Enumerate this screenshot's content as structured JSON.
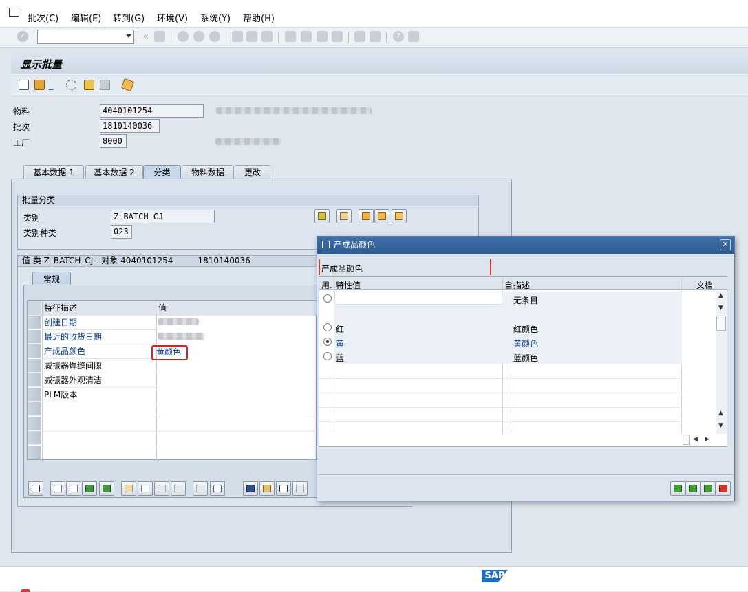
{
  "menu": [
    "批次(C)",
    "编辑(E)",
    "转到(G)",
    "环境(V)",
    "系统(Y)",
    "帮助(H)"
  ],
  "screen_title": "显示批量",
  "header": {
    "material_label": "物料",
    "material_value": "4040101254",
    "batch_label": "批次",
    "batch_value": "1810140036",
    "plant_label": "工厂",
    "plant_value": "8000"
  },
  "tabs": [
    "基本数据 1",
    "基本数据 2",
    "分类",
    "物料数据",
    "更改"
  ],
  "selected_tab": "分类",
  "batch_class": {
    "group_title": "批量分类",
    "class_label": "类别",
    "class_value": "Z_BATCH_CJ",
    "class_type_label": "类别种类",
    "class_type_value": "023"
  },
  "values": {
    "group_title": "值 类 Z_BATCH_CJ - 对象 4040101254",
    "batch_number": "1810140036",
    "subtab": "常规",
    "col_char": "特征描述",
    "col_value": "值",
    "rows": [
      {
        "char": "创建日期",
        "value": "",
        "link": true
      },
      {
        "char": "最近的收货日期",
        "value": "",
        "link": true
      },
      {
        "char": "产成品颜色",
        "value": "黄颜色",
        "link": true
      },
      {
        "char": "减振器焊缝间隙",
        "value": "",
        "link": false
      },
      {
        "char": "减振器外观清洁",
        "value": "",
        "link": false
      },
      {
        "char": "PLM版本",
        "value": "",
        "link": false
      }
    ]
  },
  "popup": {
    "title": "产成品颜色",
    "field_label": "产成品颜色",
    "col_use": "用.",
    "col_value": "特性值",
    "col_self": "自",
    "col_desc": "描述",
    "col_doc": "文档",
    "options": [
      {
        "value": "",
        "desc": "无条目",
        "selected": false
      },
      {
        "value": "红",
        "desc": "红颜色",
        "selected": false
      },
      {
        "value": "黄",
        "desc": "黄颜色",
        "selected": true
      },
      {
        "value": "蓝",
        "desc": "蓝颜色",
        "selected": false
      }
    ]
  },
  "footer_logo": "SAP"
}
